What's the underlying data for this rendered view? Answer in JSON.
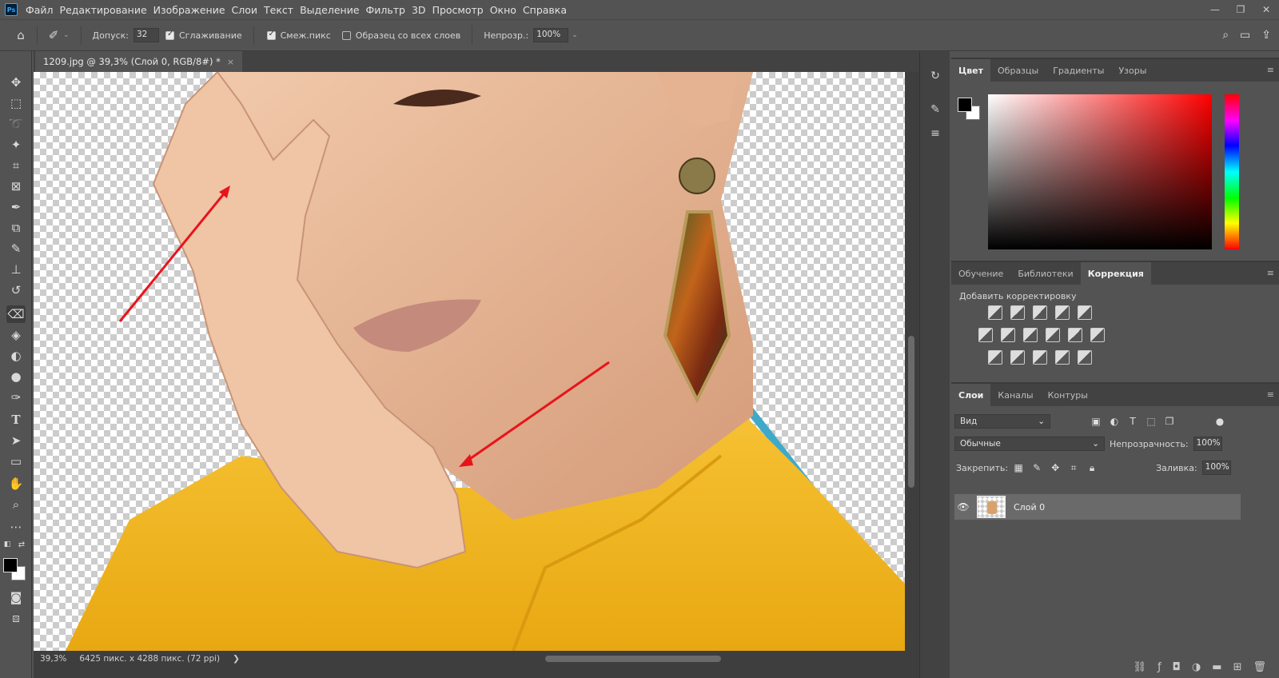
{
  "menu": [
    "Файл",
    "Редактирование",
    "Изображение",
    "Слои",
    "Текст",
    "Выделение",
    "Фильтр",
    "3D",
    "Просмотр",
    "Окно",
    "Справка"
  ],
  "app_logo": "Ps",
  "options": {
    "tolerance_label": "Допуск:",
    "tolerance_value": "32",
    "antialias_label": "Сглаживание",
    "antialias_checked": true,
    "contiguous_label": "Смеж.пикс",
    "contiguous_checked": true,
    "sample_all_label": "Образец со всех слоев",
    "sample_all_checked": false,
    "opacity_label": "Непрозр.:",
    "opacity_value": "100%"
  },
  "document_tab": {
    "title": "1209.jpg @ 39,3% (Слой 0, RGB/8#) *",
    "close": "×"
  },
  "status": {
    "zoom": "39,3%",
    "info": "6425 пикс. x 4288 пикс. (72 ppi)",
    "arrow": "❯"
  },
  "color_panel": {
    "tabs": [
      "Цвет",
      "Образцы",
      "Градиенты",
      "Узоры"
    ],
    "active_tab": 0
  },
  "adjust_panel": {
    "tabs": [
      "Обучение",
      "Библиотеки",
      "Коррекция"
    ],
    "active_tab": 2,
    "title": "Добавить корректировку"
  },
  "layers_panel": {
    "tabs": [
      "Слои",
      "Каналы",
      "Контуры"
    ],
    "active_tab": 0,
    "filter_label": "Вид",
    "blend_mode": "Обычные",
    "opacity_label": "Непрозрачность:",
    "opacity_value": "100%",
    "lock_label": "Закрепить:",
    "fill_label": "Заливка:",
    "fill_value": "100%",
    "layer_name": "Слой 0"
  },
  "colors": {
    "ui_bg": "#535353",
    "annotation_arrow": "#e8141b",
    "edge_artifact": "#3fa9c9",
    "shirt": "#f2b620"
  }
}
